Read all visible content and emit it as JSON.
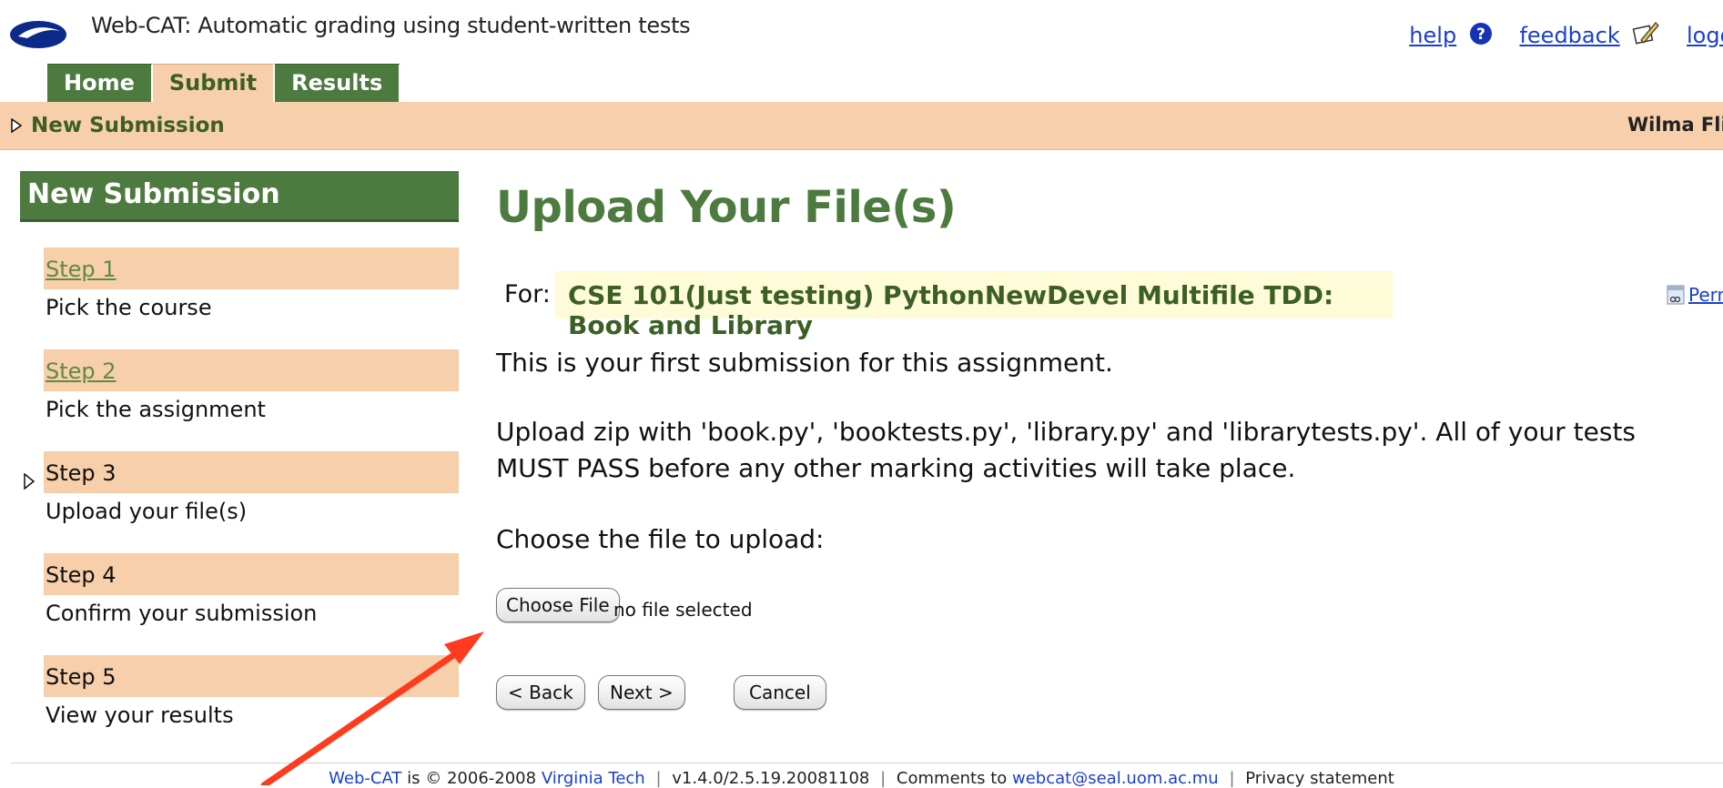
{
  "header": {
    "app_title": "Web-CAT: Automatic grading using student-written tests",
    "help_label": "help",
    "feedback_label": "feedback",
    "logout_label": "logout"
  },
  "tabs": [
    {
      "label": "Home",
      "active": false
    },
    {
      "label": "Submit",
      "active": true
    },
    {
      "label": "Results",
      "active": false
    }
  ],
  "breadcrumb": {
    "label": "New Submission"
  },
  "user": {
    "name": "Wilma Flintstone"
  },
  "sidebar": {
    "title": "New Submission",
    "steps": [
      {
        "label": "Step 1",
        "desc": "Pick the course",
        "link": true
      },
      {
        "label": "Step 2",
        "desc": "Pick the assignment",
        "link": true
      },
      {
        "label": "Step 3",
        "desc": "Upload your file(s)",
        "link": false,
        "current": true
      },
      {
        "label": "Step 4",
        "desc": "Confirm your submission",
        "link": false
      },
      {
        "label": "Step 5",
        "desc": "View your results",
        "link": false
      }
    ]
  },
  "main": {
    "title": "Upload Your File(s)",
    "for_label": "For:",
    "assignment": "CSE 101(Just testing) PythonNewDevel Multifile TDD: Book and Library",
    "permalink_label": "Permalink",
    "first_submission": "This is your first submission for this assignment.",
    "instructions": "Upload zip with 'book.py', 'booktests.py', 'library.py' and 'librarytests.py'. All of your tests MUST PASS before any other marking activities will take place.",
    "choose_label": "Choose the file to upload:",
    "choose_button": "Choose File",
    "file_status": "no file selected",
    "back_button": "< Back",
    "next_button": "Next >",
    "cancel_button": "Cancel"
  },
  "footer": {
    "brand": "Web-CAT",
    "is_text": "is",
    "copyright": "© 2006-2008",
    "org": "Virginia Tech",
    "version": "v1.4.0/2.5.19.20081108",
    "comments_label": "Comments to",
    "email": "webcat@seal.uom.ac.mu",
    "privacy": "Privacy statement"
  },
  "colors": {
    "tab_green": "#4d7a3e",
    "peach": "#f7cfaa",
    "highlight": "#fefbd8",
    "link_blue": "#1a3fd1",
    "annotation_arrow": "#ff3b1f"
  },
  "icons": [
    "logo-icon",
    "help-icon",
    "feedback-icon",
    "triangle-right-icon",
    "permalink-icon",
    "annotation-arrow"
  ]
}
